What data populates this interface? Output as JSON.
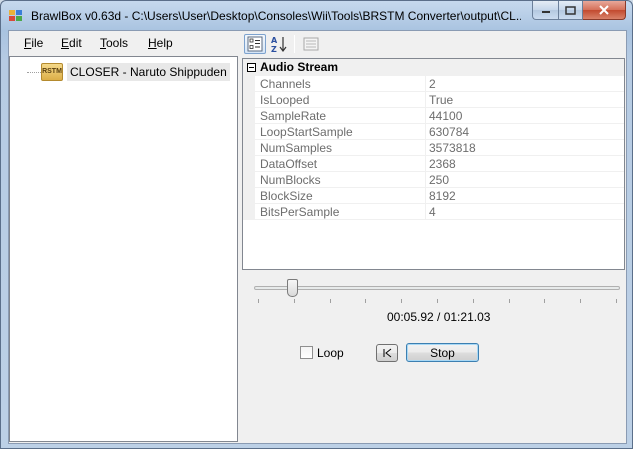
{
  "window": {
    "title": "BrawlBox v0.63d - C:\\Users\\User\\Desktop\\Consoles\\Wii\\Tools\\BRSTM Converter\\output\\CL..."
  },
  "menu": {
    "file_underline": "F",
    "file_rest": "ile",
    "edit_underline": "E",
    "edit_rest": "dit",
    "tools_underline": "T",
    "tools_rest": "ools",
    "help_underline": "H",
    "help_rest": "elp"
  },
  "tree": {
    "node_icon_text": "RSTM",
    "node_label": "CLOSER - Naruto Shippuden"
  },
  "property_grid": {
    "category": "Audio Stream",
    "properties": [
      {
        "name": "Channels",
        "value": "2"
      },
      {
        "name": "IsLooped",
        "value": "True"
      },
      {
        "name": "SampleRate",
        "value": "44100"
      },
      {
        "name": "LoopStartSample",
        "value": "630784"
      },
      {
        "name": "NumSamples",
        "value": "3573818"
      },
      {
        "name": "DataOffset",
        "value": "2368"
      },
      {
        "name": "NumBlocks",
        "value": "250"
      },
      {
        "name": "BlockSize",
        "value": "8192"
      },
      {
        "name": "BitsPerSample",
        "value": "4"
      }
    ]
  },
  "player": {
    "time": "00:05.92 / 01:21.03",
    "position_fraction": 0.073,
    "loop_label": "Loop",
    "loop_checked": false,
    "rewind_label": "|<",
    "stop_label": "Stop"
  },
  "colors": {
    "title_gradient_top": "#c6d9ee",
    "close_button": "#c24a2f",
    "selection_bg": "#e8e8e8",
    "button_focus_border": "#3c7fb1"
  }
}
